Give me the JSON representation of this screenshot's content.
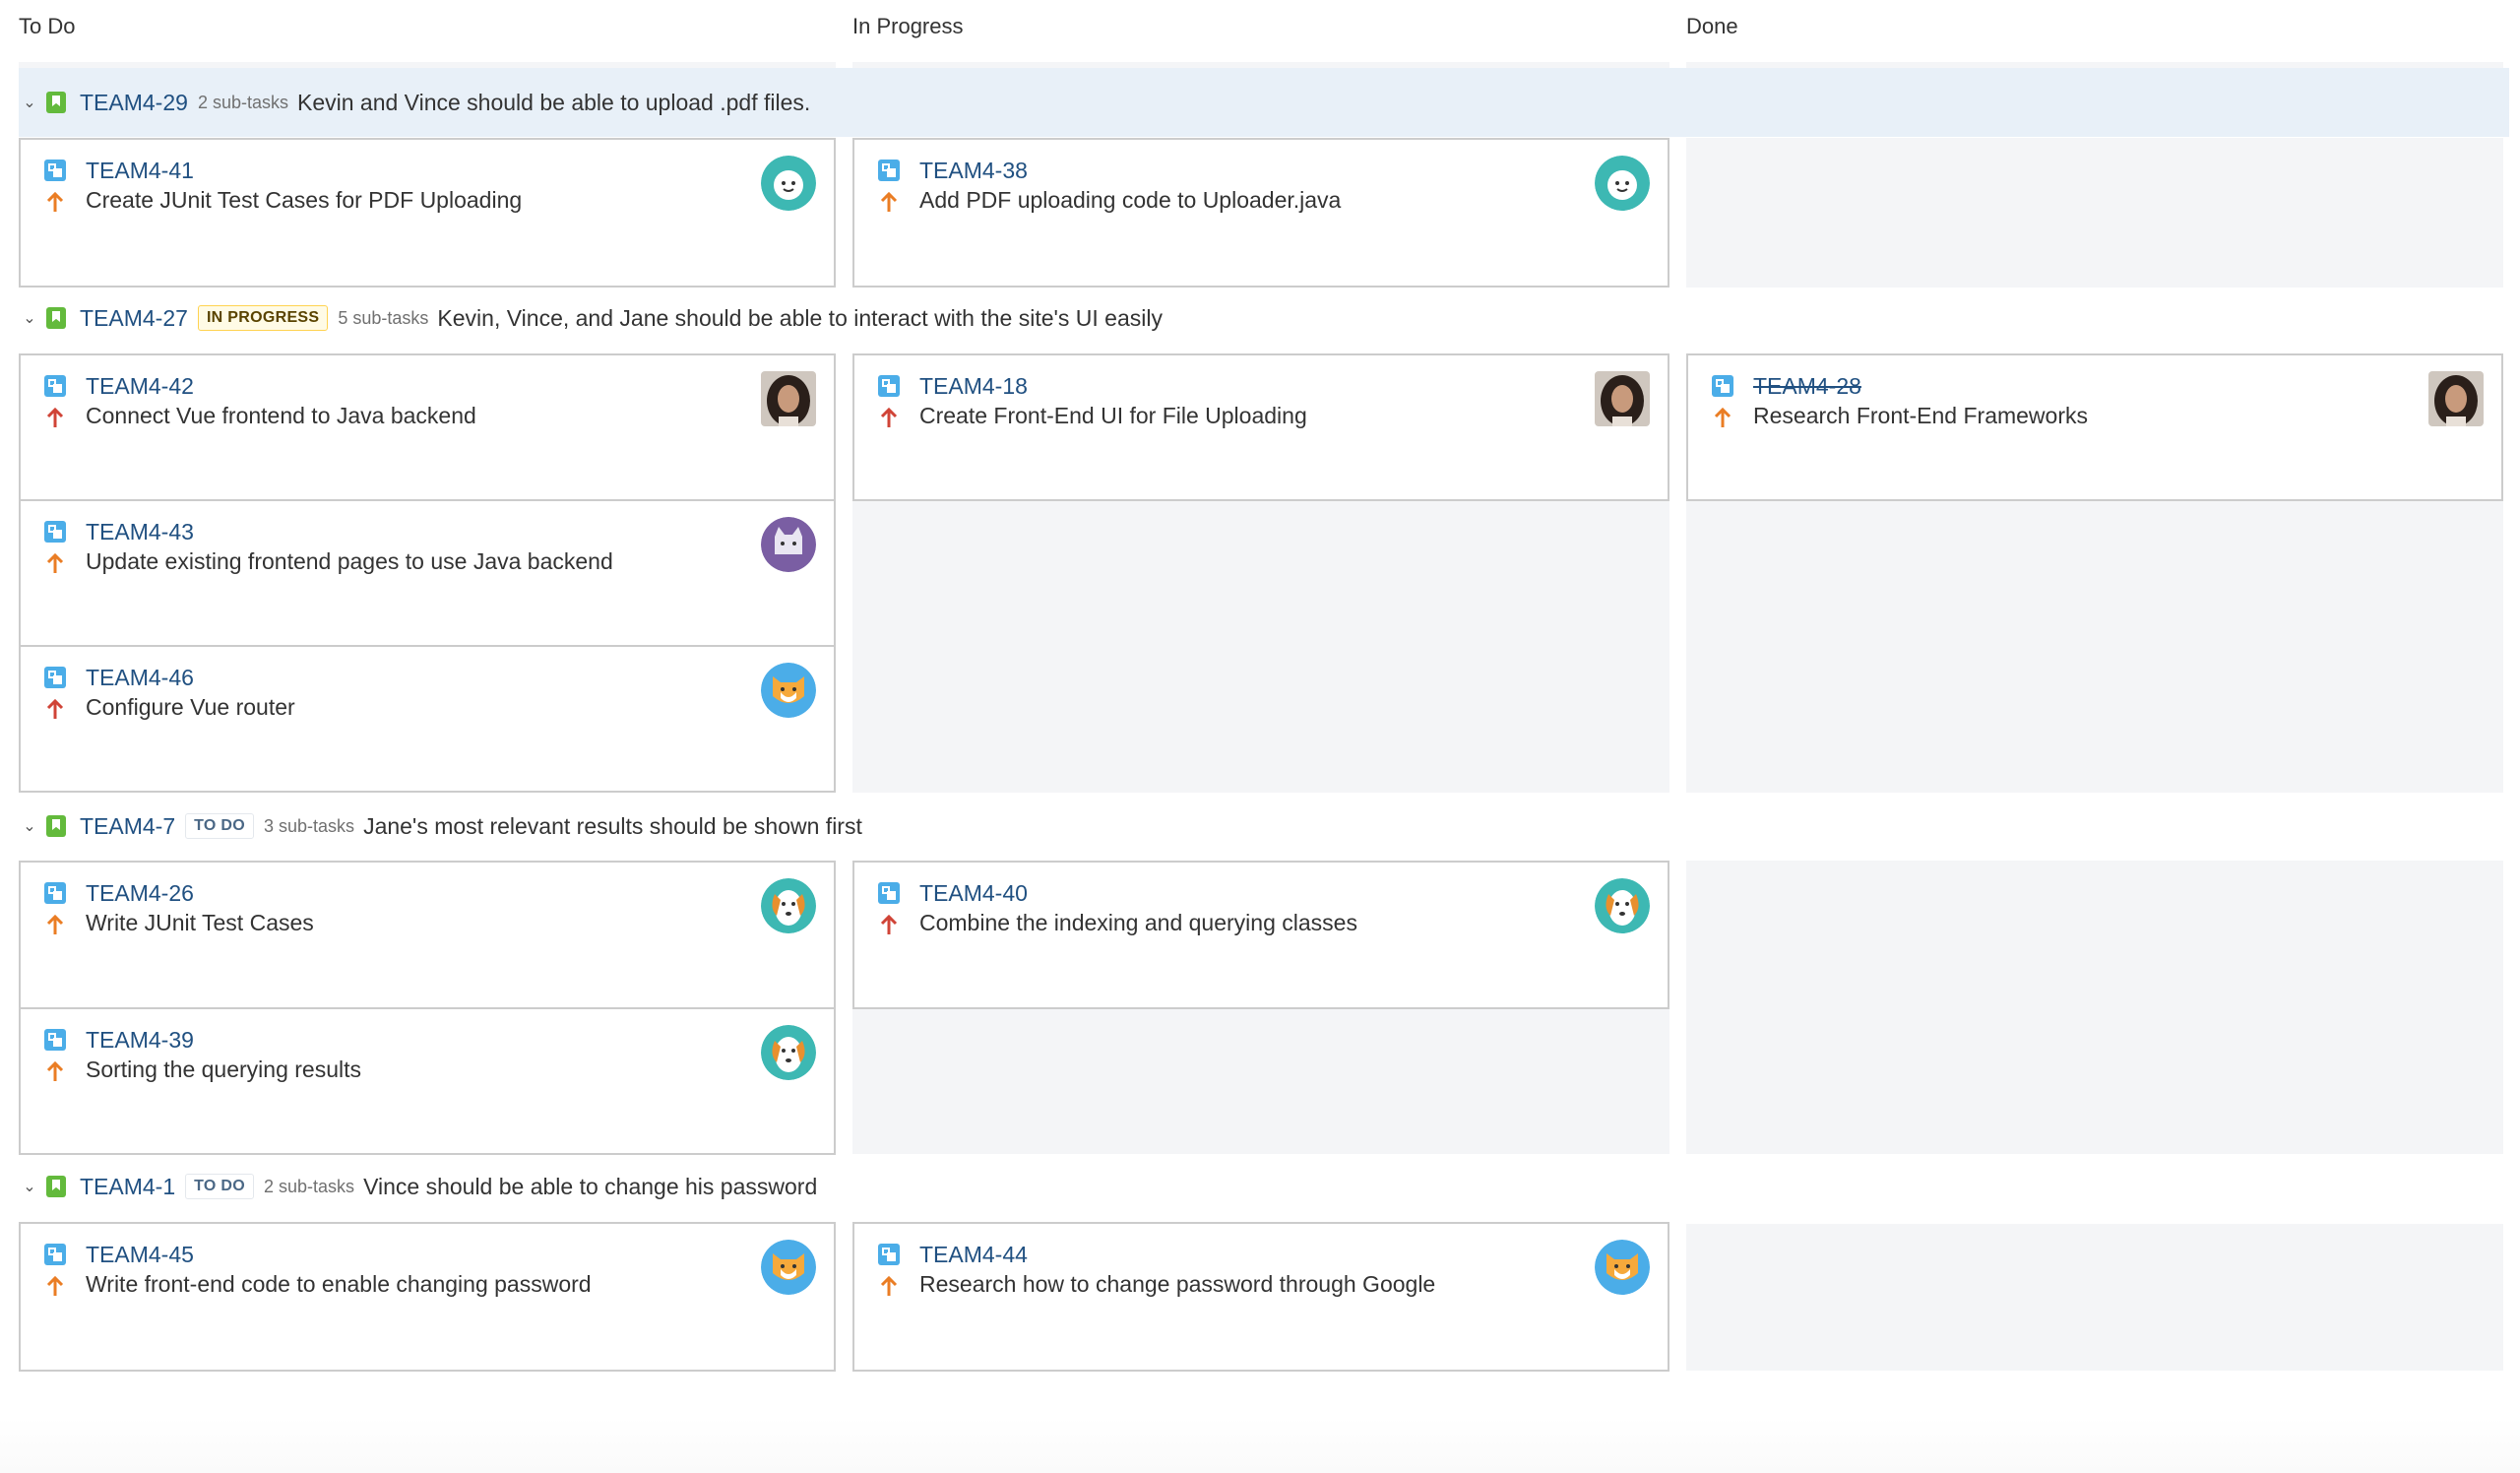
{
  "columns": [
    "To Do",
    "In Progress",
    "Done"
  ],
  "colors": {
    "link": "#205081",
    "story": "#63ba3c",
    "subtask": "#4bade8",
    "priority_high": "#d04437",
    "priority_medium": "#ea7d24"
  },
  "swimlanes": [
    {
      "key": "TEAM4-29",
      "status": "",
      "subtasks": "2 sub-tasks",
      "summary": "Kevin and Vince should be able to upload .pdf files.",
      "cards": [
        {
          "key": "TEAM4-41",
          "summary": "Create JUnit Test Cases for PDF Uploading",
          "priority": "medium",
          "avatar": "teal-face-icon"
        },
        {
          "key": "TEAM4-38",
          "summary": "Add PDF uploading code to Uploader.java",
          "priority": "medium",
          "avatar": "teal-face-icon"
        }
      ]
    },
    {
      "key": "TEAM4-27",
      "status": "IN PROGRESS",
      "subtasks": "5 sub-tasks",
      "summary": "Kevin, Vince, and Jane should be able to interact with the site's UI easily",
      "cards": [
        {
          "key": "TEAM4-42",
          "summary": "Connect Vue frontend to Java backend",
          "priority": "high",
          "avatar": "user-photo"
        },
        {
          "key": "TEAM4-43",
          "summary": "Update existing frontend pages to use Java backend",
          "priority": "medium",
          "avatar": "purple-cat-icon"
        },
        {
          "key": "TEAM4-46",
          "summary": "Configure Vue router",
          "priority": "high",
          "avatar": "fox-icon"
        },
        {
          "key": "TEAM4-18",
          "summary": "Create Front-End UI for File Uploading",
          "priority": "high",
          "avatar": "user-photo"
        },
        {
          "key": "TEAM4-28",
          "summary": "Research Front-End Frameworks",
          "priority": "medium",
          "avatar": "user-photo"
        }
      ]
    },
    {
      "key": "TEAM4-7",
      "status": "TO DO",
      "subtasks": "3 sub-tasks",
      "summary": "Jane's most relevant results should be shown first",
      "cards": [
        {
          "key": "TEAM4-26",
          "summary": "Write JUnit Test Cases",
          "priority": "medium",
          "avatar": "dog-icon"
        },
        {
          "key": "TEAM4-39",
          "summary": "Sorting the querying results",
          "priority": "medium",
          "avatar": "dog-icon"
        },
        {
          "key": "TEAM4-40",
          "summary": "Combine the indexing and querying classes",
          "priority": "high",
          "avatar": "dog-icon"
        }
      ]
    },
    {
      "key": "TEAM4-1",
      "status": "TO DO",
      "subtasks": "2 sub-tasks",
      "summary": "Vince should be able to change his password",
      "cards": [
        {
          "key": "TEAM4-45",
          "summary": "Write front-end code to enable changing password",
          "priority": "medium",
          "avatar": "fox-icon"
        },
        {
          "key": "TEAM4-44",
          "summary": "Research how to change password through Google",
          "priority": "medium",
          "avatar": "fox-icon"
        }
      ]
    }
  ]
}
